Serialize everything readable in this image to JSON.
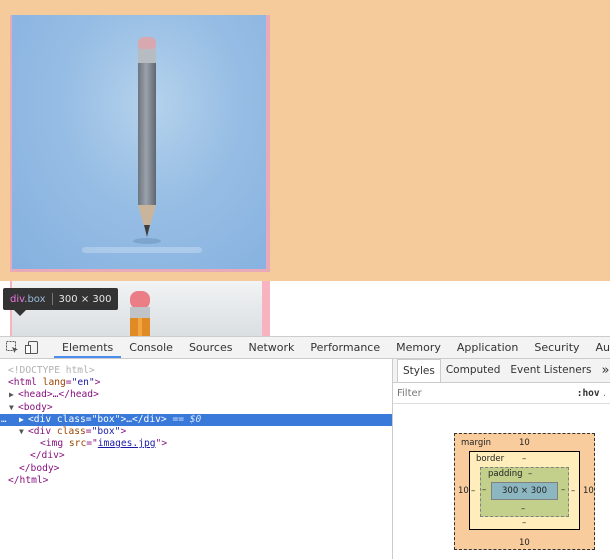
{
  "tooltip": {
    "tag": "div",
    "class_name": ".box",
    "size": "300 × 300"
  },
  "devtools": {
    "tabs": [
      "Elements",
      "Console",
      "Sources",
      "Network",
      "Performance",
      "Memory",
      "Application",
      "Security",
      "Audits"
    ],
    "active_tab": "Elements"
  },
  "dom": {
    "doctype": "<!DOCTYPE html>",
    "html_open_tag": "html",
    "html_attr": "lang",
    "html_attr_value": "\"en\"",
    "head": "<head>…</head>",
    "body_open": "<body>",
    "selected_tag": "div",
    "selected_attr": "class",
    "selected_attr_value": "\"box\"",
    "selected_rest": ">…</div>",
    "selected_marker": "== $0",
    "div_tag": "div",
    "div_attr": "class",
    "div_attr_value": "\"box\"",
    "img_tag": "img",
    "img_attr": "src",
    "img_src": "images.jpg",
    "div_close": "</div>",
    "body_close": "</body>",
    "html_close": "</html>",
    "ellipsis": "…"
  },
  "styles": {
    "tabs": [
      "Styles",
      "Computed",
      "Event Listeners"
    ],
    "more": "»",
    "filter_placeholder": "Filter",
    "hov": ":hov",
    "trailing": "."
  },
  "box_model": {
    "margin_label": "margin",
    "margin_top": "10",
    "margin_bottom": "10",
    "margin_left": "10",
    "margin_right": "10",
    "border_label": "border",
    "border_top": "–",
    "border_bottom": "–",
    "border_left": "–",
    "border_right": "–",
    "padding_label": "padding",
    "padding_top": "–",
    "padding_bottom": "–",
    "padding_left": "–",
    "padding_right": "–",
    "content": "300 × 300"
  },
  "colors": {
    "margin_highlight": "#f6cb9b",
    "content_highlight": "#e8aab9",
    "selection": "#3879d9",
    "active_tab_underline": "#4b8ef0"
  }
}
